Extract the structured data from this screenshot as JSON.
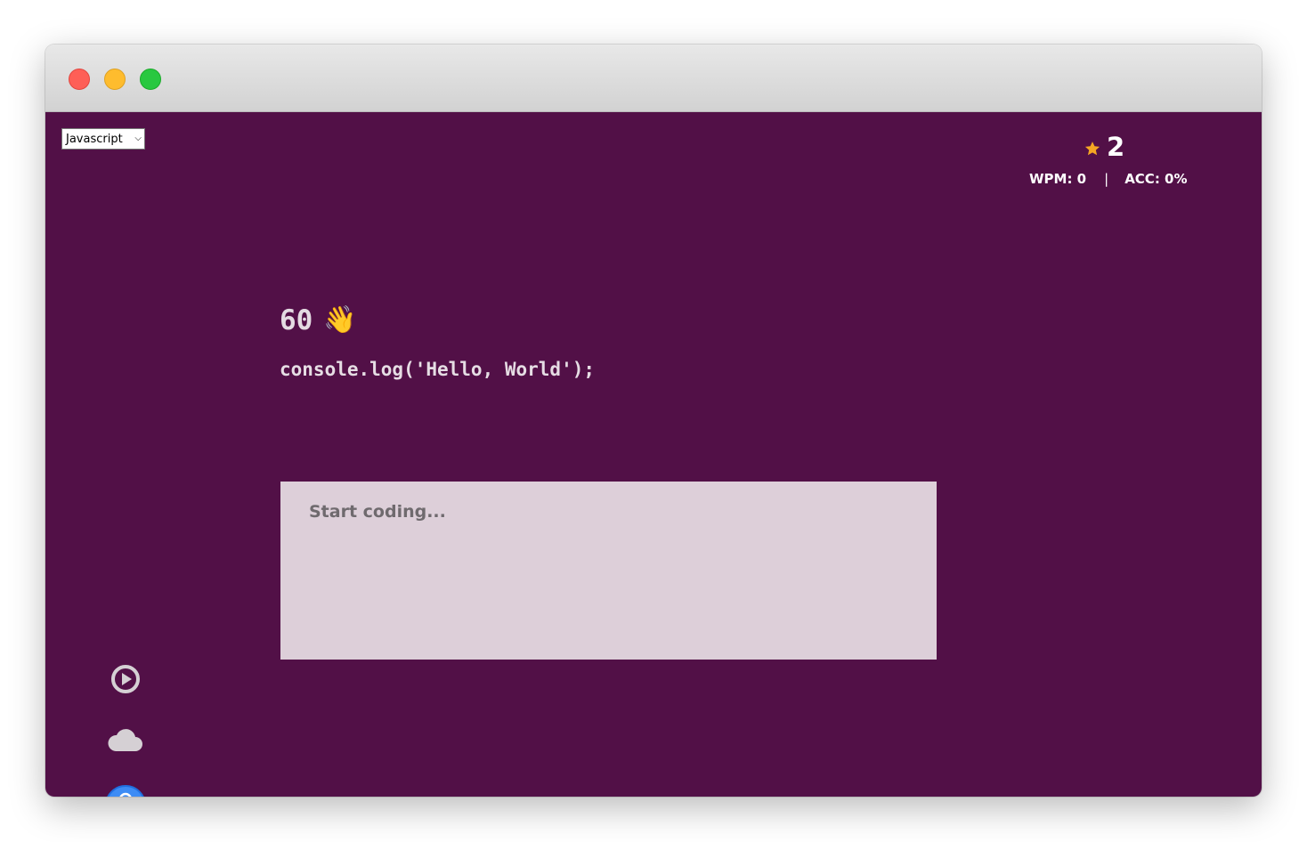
{
  "window": {
    "traffic_lights": [
      "close",
      "minimize",
      "maximize"
    ]
  },
  "language_select": {
    "selected": "Javascript",
    "icon": "chevron-down-icon"
  },
  "stats": {
    "score": "2",
    "score_icon": "star-icon",
    "star_color": "#f5a623",
    "wpm_label": "WPM: 0",
    "separator": "|",
    "acc_label": "ACC: 0%"
  },
  "challenge": {
    "timer": "60",
    "timer_emoji": "👋",
    "code": "console.log('Hello, World');"
  },
  "editor": {
    "placeholder": "Start coding..."
  },
  "sidebar": {
    "icons": [
      "play-icon",
      "cloud-icon",
      "user-avatar-icon"
    ]
  },
  "colors": {
    "background": "#521047",
    "editor_background": "#ddcfd9",
    "accent_blue": "#3d8cf5"
  }
}
